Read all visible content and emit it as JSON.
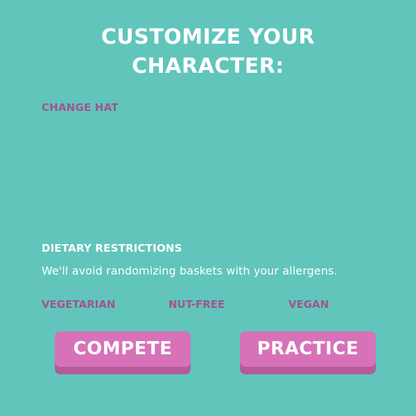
{
  "title": {
    "line1": "CUSTOMIZE YOUR",
    "line2": "CHARACTER:"
  },
  "hat": {
    "label": "CHANGE HAT"
  },
  "dietary": {
    "label": "DIETARY RESTRICTIONS",
    "description": "We'll avoid randomizing baskets with your allergens.",
    "options": [
      "VEGETARIAN",
      "NUT-FREE",
      "VEGAN"
    ]
  },
  "buttons": {
    "compete": "COMPETE",
    "practice": "PRACTICE"
  },
  "colors": {
    "background": "#61c5bb",
    "accent_text": "#a0558d",
    "button_face": "#d872b8",
    "button_shadow": "#b35c9c"
  }
}
